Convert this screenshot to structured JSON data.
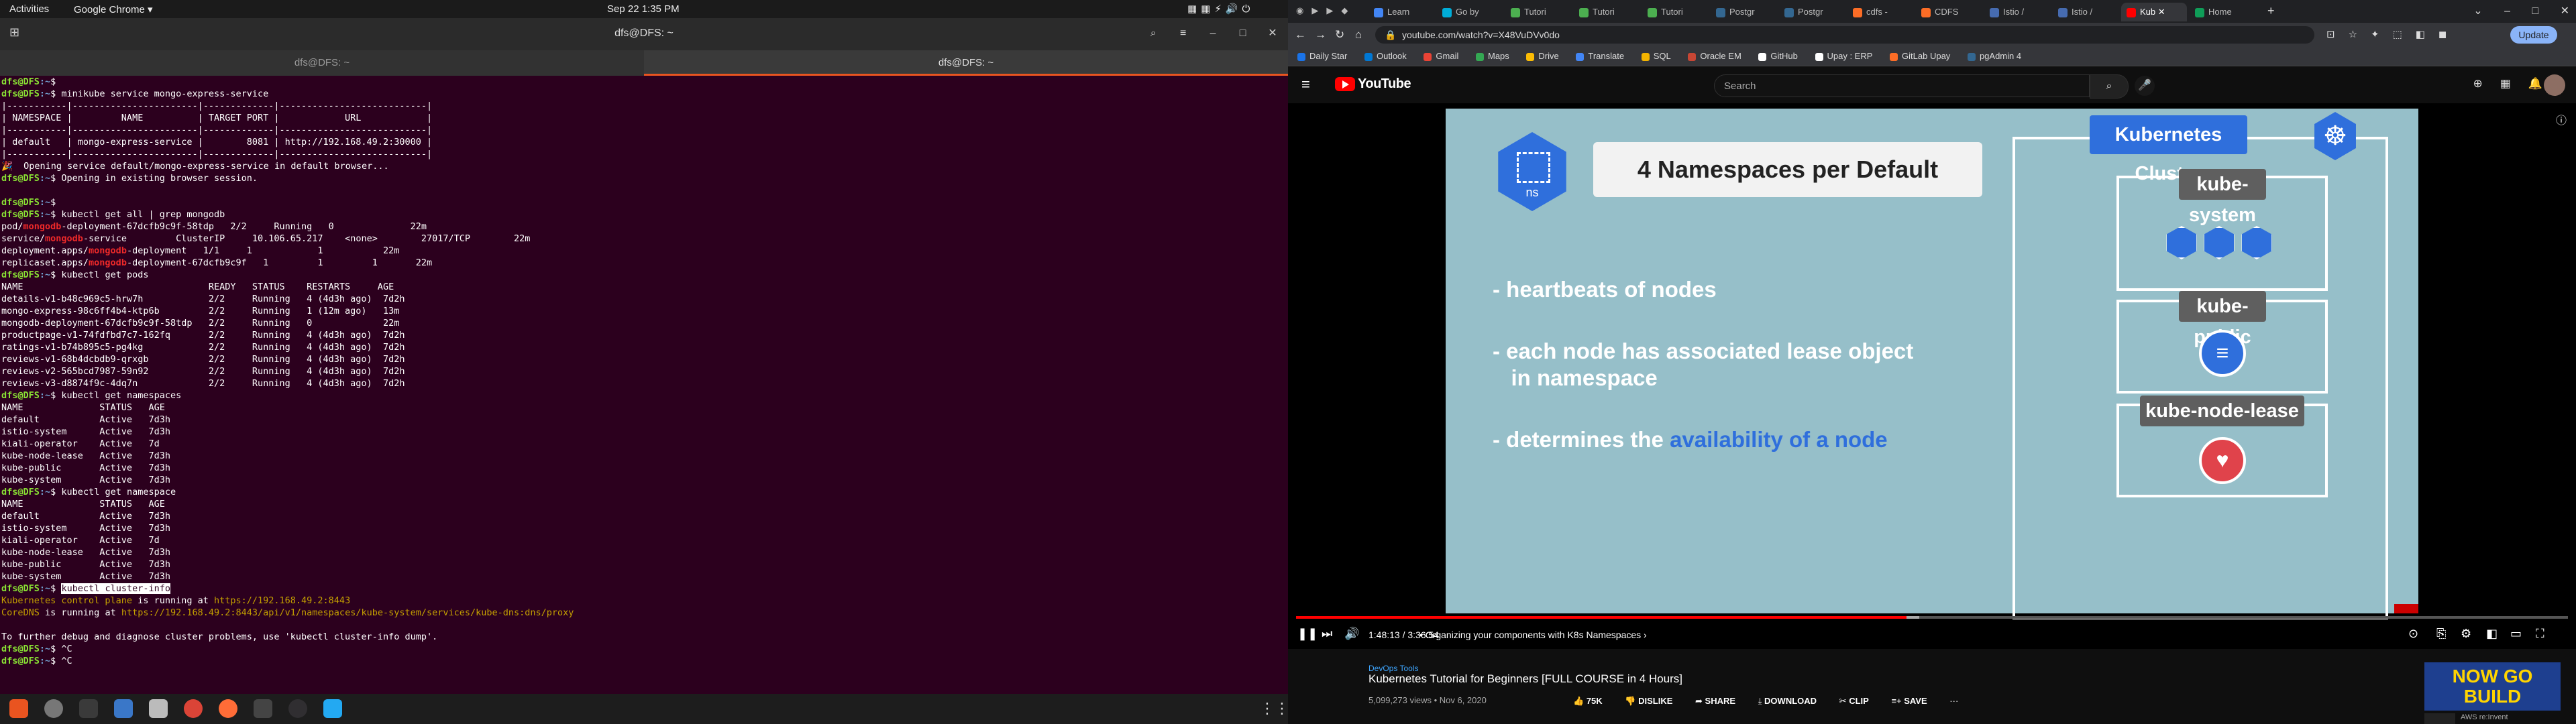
{
  "topbar": {
    "activities": "Activities",
    "app_name": "Google Chrome ▾",
    "clock": "Sep 22  1:35 PM"
  },
  "terminal": {
    "title": "dfs@DFS: ~",
    "tabs": [
      "dfs@DFS: ~",
      "dfs@DFS: ~"
    ],
    "prompt_user": "dfs@DFS",
    "prompt_path": ":~",
    "cmd_minikube": "$ minikube service mongo-express-service",
    "minikube_table": [
      "|-----------|-----------------------|-------------|---------------------------|",
      "| NAMESPACE |         NAME          | TARGET PORT |            URL            |",
      "|-----------|-----------------------|-------------|---------------------------|",
      "| default   | mongo-express-service |        8081 | http://192.168.49.2:30000 |",
      "|-----------|-----------------------|-------------|---------------------------|"
    ],
    "opening_1": "🎉  Opening service default/mongo-express-service in default browser...",
    "opening_2": "$ Opening in existing browser session.",
    "blank_prompt": "$",
    "cmd_getall": "$ kubectl get all | grep mongodb",
    "grep_lines": [
      {
        "pre": "pod/",
        "hl": "mongodb",
        "post": "-deployment-67dcfb9c9f-58tdp   2/2     Running   0              22m"
      },
      {
        "pre": "service/",
        "hl": "mongodb",
        "post": "-service         ClusterIP     10.106.65.217    <none>        27017/TCP        22m"
      },
      {
        "pre": "deployment.apps/",
        "hl": "mongodb",
        "post": "-deployment   1/1     1            1           22m"
      },
      {
        "pre": "replicaset.apps/",
        "hl": "mongodb",
        "post": "-deployment-67dcfb9c9f   1         1         1       22m"
      }
    ],
    "cmd_pods": "$ kubectl get pods",
    "pods_header": "NAME                                  READY   STATUS    RESTARTS     AGE",
    "pods": [
      "details-v1-b48c969c5-hrw7h            2/2     Running   4 (4d3h ago)  7d2h",
      "mongo-express-98c6ff4b4-ktp6b         2/2     Running   1 (12m ago)   13m",
      "mongodb-deployment-67dcfb9c9f-58tdp   2/2     Running   0             22m",
      "productpage-v1-74fdfbd7c7-162fq       2/2     Running   4 (4d3h ago)  7d2h",
      "ratings-v1-b74b895c5-pg4kg            2/2     Running   4 (4d3h ago)  7d2h",
      "reviews-v1-68b4dcbdb9-qrxgb           2/2     Running   4 (4d3h ago)  7d2h",
      "reviews-v2-565bcd7987-59n92           2/2     Running   4 (4d3h ago)  7d2h",
      "reviews-v3-d8874f9c-4dq7n             2/2     Running   4 (4d3h ago)  7d2h"
    ],
    "cmd_namespaces": "$ kubectl get namespaces",
    "ns_header": "NAME              STATUS   AGE",
    "namespaces": [
      "default           Active   7d3h",
      "istio-system      Active   7d3h",
      "kiali-operator    Active   7d",
      "kube-node-lease   Active   7d3h",
      "kube-public       Active   7d3h",
      "kube-system       Active   7d3h"
    ],
    "cmd_namespace": "$ kubectl get namespace",
    "cmd_clusterinfo_sep": "$ ",
    "cmd_clusterinfo": "kubectl cluster-info",
    "cp_pre": "Kubernetes control plane",
    "cp_mid": " is running at ",
    "cp_url": "https://192.168.49.2:8443",
    "dns_pre": "CoreDNS",
    "dns_mid": " is running at ",
    "dns_url": "https://192.168.49.2:8443/api/v1/namespaces/kube-system/services/kube-dns:dns/proxy",
    "debug_note": "To further debug and diagnose cluster problems, use 'kubectl cluster-info dump'.",
    "ctrlc": "$ ^C",
    "last_prompt": "$ "
  },
  "chrome": {
    "tabs": [
      {
        "label": "Learn",
        "color": "#4285f4"
      },
      {
        "label": "Go by",
        "color": "#00add8"
      },
      {
        "label": "Tutori",
        "color": "#4caf50"
      },
      {
        "label": "Tutori",
        "color": "#4caf50"
      },
      {
        "label": "Tutori",
        "color": "#4caf50"
      },
      {
        "label": "Postgr",
        "color": "#336791"
      },
      {
        "label": "Postgr",
        "color": "#336791"
      },
      {
        "label": "cdfs - ",
        "color": "#fc6d26"
      },
      {
        "label": "CDFS",
        "color": "#fc6d26"
      },
      {
        "label": "Istio /",
        "color": "#466bb0"
      },
      {
        "label": "Istio /",
        "color": "#466bb0"
      },
      {
        "label": "Kub",
        "color": "#ff0000"
      },
      {
        "label": "Home",
        "color": "#0f9d58"
      }
    ],
    "url": "youtube.com/watch?v=X48VuDVv0do",
    "update_label": "Update",
    "bookmarks": [
      "Daily Star",
      "Outlook",
      "Gmail",
      "Maps",
      "Drive",
      "Translate",
      "SQL",
      "Oracle EM",
      "GitHub",
      "Upay : ERP",
      "GitLab Upay",
      "pgAdmin 4"
    ]
  },
  "youtube": {
    "logo_text": "YouTube",
    "search_placeholder": "Search",
    "slide": {
      "ns_label": "ns",
      "title": "4 Namespaces per Default",
      "bullet1": "- heartbeats of nodes",
      "bullet2": "- each node has associated lease object\n   in namespace",
      "bullet3_pre": "- determines the ",
      "bullet3_hl": "availability of a node",
      "cluster_title": "Kubernetes Cluster",
      "ns1": "kube-system",
      "ns2": "kube-public",
      "ns3": "kube-node-lease"
    },
    "progress_fraction": 0.48,
    "buffer_fraction": 0.49,
    "time": "1:48:13 / 3:36:54",
    "chapter": "•  Organizing your components with K8s Namespaces  ›",
    "channel": "DevOps Tools",
    "video_title": "Kubernetes Tutorial for Beginners [FULL COURSE in 4 Hours]",
    "meta": "5,099,273 views • Nov 6, 2020",
    "likes": "75K",
    "dislike": "DISLIKE",
    "share": "SHARE",
    "download": "DOWNLOAD",
    "clip": "CLIP",
    "save": "SAVE",
    "more": "···",
    "ad_text": "NOW GO BUILD",
    "ad_next": "AWS re:Invent"
  }
}
